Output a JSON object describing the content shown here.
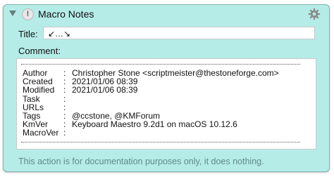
{
  "header": {
    "title": "Macro Notes",
    "warning_glyph": "!",
    "icons": [
      "disclosure-triangle-icon",
      "warning-icon",
      "gear-icon"
    ]
  },
  "fields": {
    "title_label": "Title:",
    "title_value": "↙…↘",
    "comment_label": "Comment:"
  },
  "comment": {
    "rows": [
      {
        "key": "Author",
        "colon": ":",
        "value": "Christopher Stone <scriptmeister@thestoneforge.com>"
      },
      {
        "key": "Created",
        "colon": ":",
        "value": "2021/01/06 08:39"
      },
      {
        "key": "Modified",
        "colon": ":",
        "value": "2021/01/06 08:39"
      },
      {
        "key": "Task",
        "colon": ":",
        "value": ""
      },
      {
        "key": "URLs",
        "colon": ":",
        "value": ""
      },
      {
        "key": "Tags",
        "colon": ":",
        "value": "@ccstone, @KMForum"
      },
      {
        "key": "KmVer",
        "colon": ":",
        "value": "Keyboard Maestro 9.2d1 on macOS 10.12.6"
      },
      {
        "key": "MacroVer",
        "colon": ":",
        "value": ""
      }
    ]
  },
  "footer": {
    "text": "This action is for documentation purposes only, it does nothing."
  },
  "colors": {
    "panel_bg": "#b6ece8",
    "panel_border": "#7fb7b2",
    "footer_text": "#5e8b88"
  }
}
